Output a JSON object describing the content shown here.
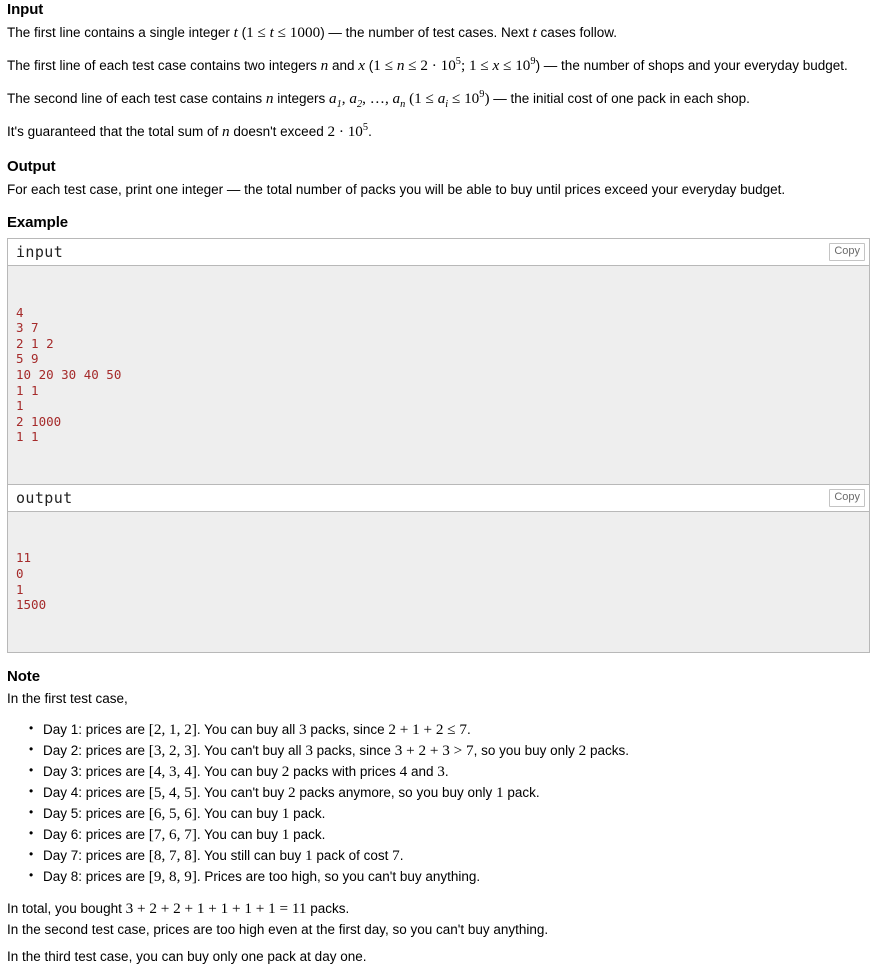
{
  "sections": {
    "input": {
      "heading": "Input",
      "p1": {
        "a": "The first line contains a single integer ",
        "var": "t",
        "b": " (",
        "math": "1 ≤ t ≤ 1000",
        "c": ") — the number of test cases. Next ",
        "var2": "t",
        "d": " cases follow."
      },
      "p2": {
        "a": "The first line of each test case contains two integers ",
        "var": "n",
        "b": " and ",
        "var2": "x",
        "c": " (",
        "math": "1 ≤ n ≤ 2 · 10^5; 1 ≤ x ≤ 10^9",
        "d": ") — the number of shops and your everyday budget."
      },
      "p3": {
        "a": "The second line of each test case contains ",
        "var": "n",
        "b": " integers ",
        "math": "a_1, a_2, …, a_n (1 ≤ a_i ≤ 10^9)",
        "c": " — the initial cost of one pack in each shop."
      },
      "p4": {
        "a": "It's guaranteed that the total sum of ",
        "var": "n",
        "b": " doesn't exceed ",
        "math": "2 · 10^5",
        "c": "."
      }
    },
    "output": {
      "heading": "Output",
      "text": "For each test case, print one integer — the total number of packs you will be able to buy until prices exceed your everyday budget."
    },
    "example": {
      "heading": "Example",
      "copy_label": "Copy",
      "blocks": [
        {
          "title": "input",
          "lines": [
            "4",
            "3 7",
            "2 1 2",
            "5 9",
            "10 20 30 40 50",
            "1 1",
            "1",
            "2 1000",
            "1 1"
          ]
        },
        {
          "title": "output",
          "lines": [
            "11",
            "0",
            "1",
            "1500"
          ]
        }
      ]
    },
    "note": {
      "heading": "Note",
      "intro": "In the first test case,",
      "days": [
        {
          "a": "Day 1: prices are ",
          "arr": "[2, 1, 2]",
          "b": ". You can buy all ",
          "n1": "3",
          "c": " packs, since ",
          "expr": "2 + 1 + 2 ≤ 7",
          "d": ".",
          "e": "",
          "n2": "",
          "f": ""
        },
        {
          "a": "Day 2: prices are ",
          "arr": "[3, 2, 3]",
          "b": ". You can't buy all ",
          "n1": "3",
          "c": " packs, since ",
          "expr": "3 + 2 + 3 > 7",
          "d": ", so you buy only ",
          "e": "",
          "n2": "2",
          "f": " packs."
        },
        {
          "a": "Day 3: prices are ",
          "arr": "[4, 3, 4]",
          "b": ". You can buy ",
          "n1": "2",
          "c": " packs with prices ",
          "expr": "4",
          "d": " and ",
          "e": "",
          "n2": "3",
          "f": "."
        },
        {
          "a": "Day 4: prices are ",
          "arr": "[5, 4, 5]",
          "b": ". You can't buy ",
          "n1": "2",
          "c": " packs anymore, so you buy only ",
          "expr": "1",
          "d": " pack.",
          "e": "",
          "n2": "",
          "f": ""
        },
        {
          "a": "Day 5: prices are ",
          "arr": "[6, 5, 6]",
          "b": ". You can buy ",
          "n1": "1",
          "c": " pack.",
          "expr": "",
          "d": "",
          "e": "",
          "n2": "",
          "f": ""
        },
        {
          "a": "Day 6: prices are ",
          "arr": "[7, 6, 7]",
          "b": ". You can buy ",
          "n1": "1",
          "c": " pack.",
          "expr": "",
          "d": "",
          "e": "",
          "n2": "",
          "f": ""
        },
        {
          "a": "Day 7: prices are ",
          "arr": "[8, 7, 8]",
          "b": ". You still can buy ",
          "n1": "1",
          "c": " pack of cost ",
          "expr": "7",
          "d": ".",
          "e": "",
          "n2": "",
          "f": ""
        },
        {
          "a": "Day 8: prices are ",
          "arr": "[9, 8, 9]",
          "b": ". Prices are too high, so you can't buy anything.",
          "n1": "",
          "c": "",
          "expr": "",
          "d": "",
          "e": "",
          "n2": "",
          "f": ""
        }
      ],
      "total": {
        "a": "In total, you bought ",
        "expr": "3 + 2 + 2 + 1 + 1 + 1 + 1 = 11",
        "b": " packs."
      },
      "second_case": "In the second test case, prices are too high even at the first day, so you can't buy anything.",
      "third_case": "In the third test case, you can buy only one pack at day one."
    }
  },
  "colors": {
    "code_text": "#a52a2a",
    "code_bg": "#eeeeee",
    "border": "#b8b8b8",
    "copy_text": "#6b6b6b"
  }
}
